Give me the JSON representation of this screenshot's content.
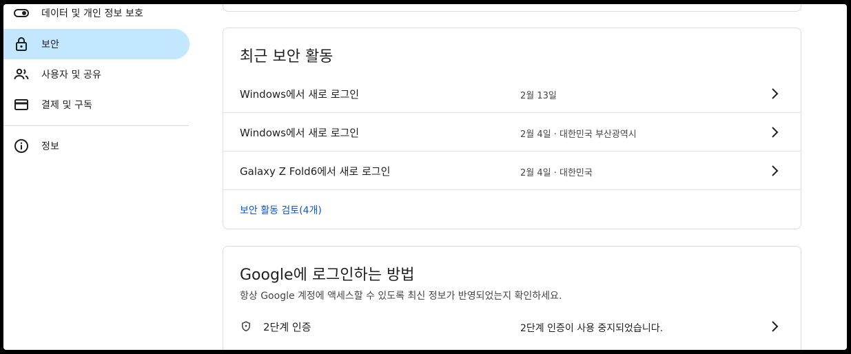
{
  "sidebar": {
    "items": [
      {
        "label": "데이터 및 개인 정보 보호",
        "icon": "toggle-icon"
      },
      {
        "label": "보안",
        "icon": "lock-icon"
      },
      {
        "label": "사용자 및 공유",
        "icon": "people-icon"
      },
      {
        "label": "결제 및 구독",
        "icon": "credit-card-icon"
      },
      {
        "label": "정보",
        "icon": "info-icon"
      }
    ]
  },
  "security_activity": {
    "title": "최근 보안 활동",
    "events": [
      {
        "label": "Windows에서 새로 로그인",
        "detail": "2월 13일"
      },
      {
        "label": "Windows에서 새로 로그인",
        "detail": "2월 4일 · 대한민국 부산광역시"
      },
      {
        "label": "Galaxy Z Fold6에서 새로 로그인",
        "detail": "2월 4일 · 대한민국"
      }
    ],
    "review_link": "보안 활동 검토(4개)"
  },
  "signin": {
    "title": "Google에 로그인하는 방법",
    "subtitle": "항상 Google 계정에 액세스할 수 있도록 최신 정보가 반영되었는지 확인하세요.",
    "two_step": {
      "label": "2단계 인증",
      "status": "2단계 인증이 사용 중지되었습니다.",
      "icon": "shield-icon"
    }
  },
  "colors": {
    "active_nav": "#c2e7ff",
    "link": "#0b57d0"
  }
}
